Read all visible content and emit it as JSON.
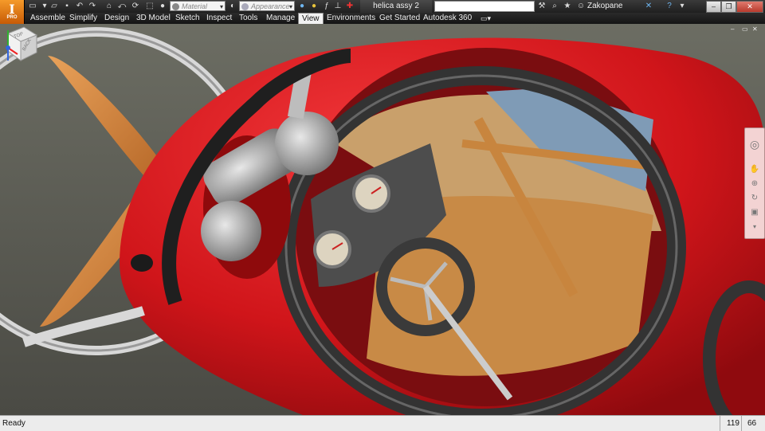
{
  "app": {
    "logo_letter": "I",
    "logo_sub": "PRO",
    "document_title": "helica assy 2",
    "user_name": "Zakopane"
  },
  "quick_access": {
    "material_placeholder": "Material",
    "appearance_placeholder": "Appearance",
    "icons": [
      "new-icon",
      "open-icon",
      "save-icon",
      "undo-icon",
      "redo-icon",
      "home-icon",
      "return-icon",
      "update-icon",
      "select-icon",
      "material-icon",
      "appearance-icon",
      "clear-icon",
      "adjust-icon",
      "function-icon",
      "measure-icon",
      "cross-icon"
    ]
  },
  "ribbon": {
    "tabs": [
      "Assemble",
      "Simplify",
      "Design",
      "3D Model",
      "Sketch",
      "Inspect",
      "Tools",
      "Manage",
      "View",
      "Environments",
      "Get Started",
      "Autodesk 360"
    ],
    "active_tab": "View"
  },
  "viewcube": {
    "top_label": "TOP",
    "back_label": "BACK"
  },
  "status": {
    "text": "Ready",
    "count1": "119",
    "count2": "66"
  },
  "colors": {
    "accent": "#e06a10",
    "body_red": "#d4141b",
    "status_bar": "#ececec"
  }
}
